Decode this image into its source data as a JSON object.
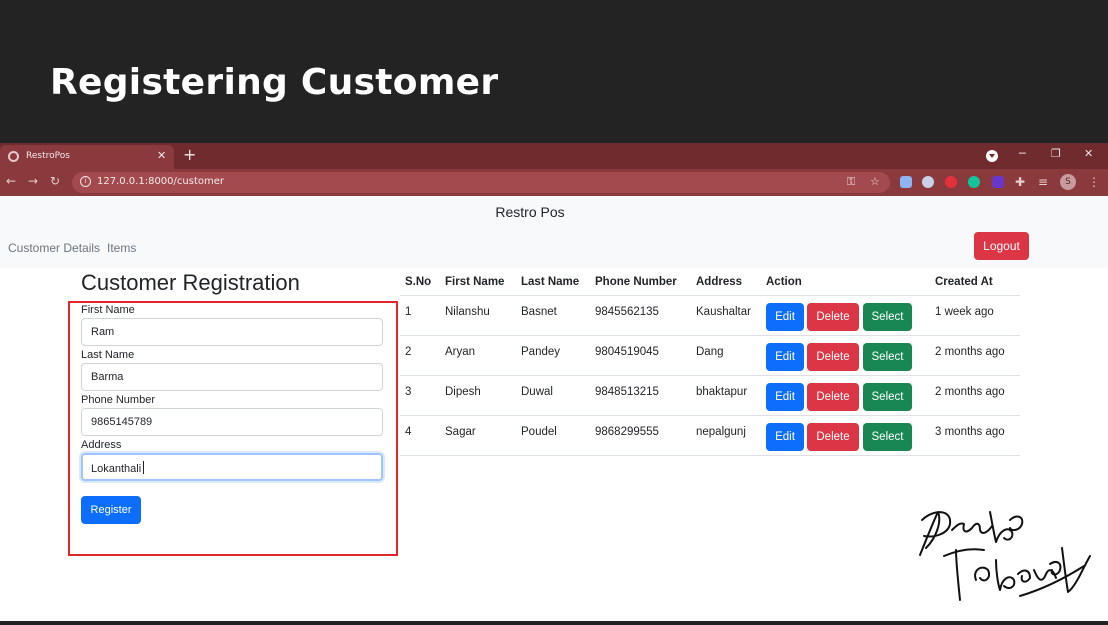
{
  "slide": {
    "title": "Registering Customer"
  },
  "browser": {
    "tab_title": "RestroPos",
    "tab_close": "✕",
    "new_tab": "+",
    "url": "127.0.0.1:8000/customer",
    "avatar_letter": "S"
  },
  "navbar": {
    "brand": "Restro Pos",
    "links": [
      "Customer Details",
      "Items"
    ],
    "logout": "Logout"
  },
  "form": {
    "title": "Customer Registration",
    "fields": [
      {
        "label": "First Name",
        "value": "Ram"
      },
      {
        "label": "Last Name",
        "value": "Barma"
      },
      {
        "label": "Phone Number",
        "value": "9865145789"
      },
      {
        "label": "Address",
        "value": "Lokanthali"
      }
    ],
    "submit": "Register"
  },
  "table": {
    "headers": [
      "S.No",
      "First Name",
      "Last Name",
      "Phone Number",
      "Address",
      "Action",
      "Created At"
    ],
    "buttons": {
      "edit": "Edit",
      "delete": "Delete",
      "select": "Select"
    },
    "rows": [
      {
        "sno": "1",
        "first": "Nilanshu",
        "last": "Basnet",
        "phone": "9845562135",
        "address": "Kaushaltar",
        "created": "1 week ago"
      },
      {
        "sno": "2",
        "first": "Aryan",
        "last": "Pandey",
        "phone": "9804519045",
        "address": "Dang",
        "created": "2 months ago"
      },
      {
        "sno": "3",
        "first": "Dipesh",
        "last": "Duwal",
        "phone": "9848513215",
        "address": "bhaktapur",
        "created": "2 months ago"
      },
      {
        "sno": "4",
        "first": "Sagar",
        "last": "Poudel",
        "phone": "9868299555",
        "address": "nepalgunj",
        "created": "3 months ago"
      }
    ]
  },
  "colors": {
    "primary": "#0d6efd",
    "danger": "#dc3545",
    "success": "#198754",
    "highlight": "#e3262a",
    "chrome": "#8a3a3d"
  },
  "signature": "Pradip Sobhreshtha"
}
